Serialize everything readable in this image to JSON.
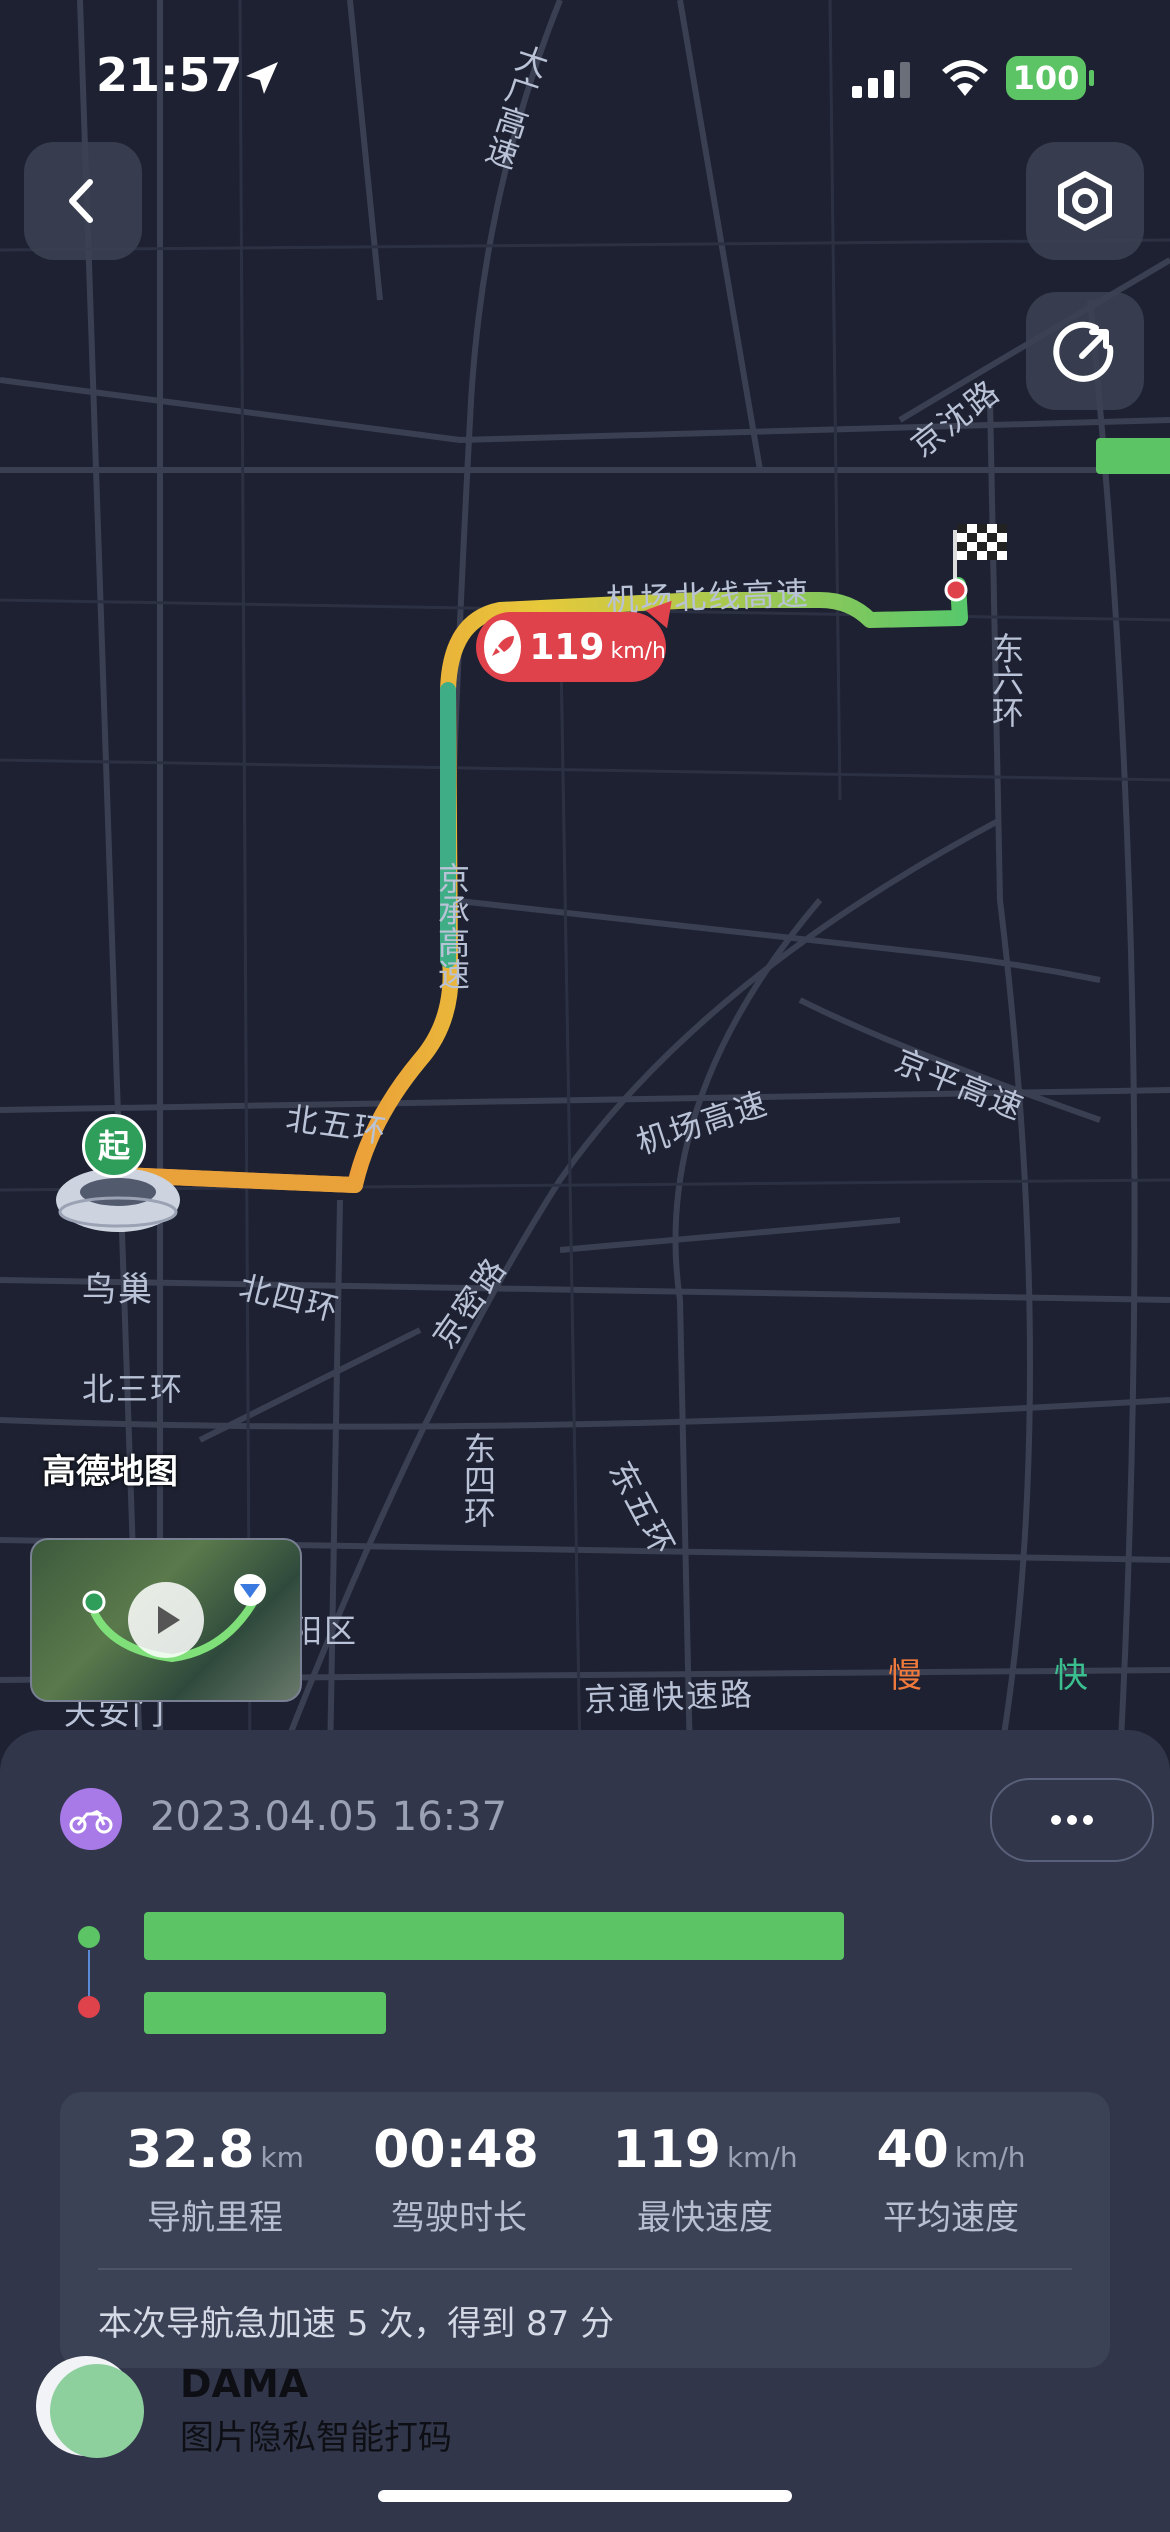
{
  "status_bar": {
    "time": "21:57",
    "battery": "100"
  },
  "map": {
    "labels": {
      "daguang": "大广高速",
      "jingshen": "京沈路",
      "jichang_bei": "机场北线高速",
      "dongliu": "东六环",
      "jingcheng": "京承高速",
      "jichang": "机场高速",
      "jingping": "京平高速",
      "beiwu": "北五环",
      "niaochao": "鸟巢",
      "beisi": "北四环",
      "jingmi": "京密路",
      "beisan": "北三环",
      "gaode": "高德地图",
      "dongsi": "东四环",
      "dongwu": "东五环",
      "chaoyang": "阳区",
      "tiananmen": "天安门",
      "jingtong": "京通快速路"
    },
    "start_marker": "起",
    "speed_bubble": {
      "value": "119",
      "unit": "km/h"
    },
    "legend": {
      "slow": "慢",
      "fast": "快"
    }
  },
  "trip": {
    "datetime": "2023.04.05 16:37",
    "stats": [
      {
        "value": "32.8",
        "unit": "km",
        "label": "导航里程"
      },
      {
        "value": "00:48",
        "unit": "",
        "label": "驾驶时长"
      },
      {
        "value": "119",
        "unit": "km/h",
        "label": "最快速度"
      },
      {
        "value": "40",
        "unit": "km/h",
        "label": "平均速度"
      }
    ],
    "summary": "本次导航急加速 5 次，得到 87 分"
  },
  "watermark": {
    "title": "DAMA",
    "subtitle": "图片隐私智能打码"
  },
  "colors": {
    "accent_green": "#5cc465",
    "end_red": "#e0424b",
    "bubble_red": "#e0424b",
    "sheet_bg": "#31364a",
    "map_bg": "#1d2131"
  }
}
